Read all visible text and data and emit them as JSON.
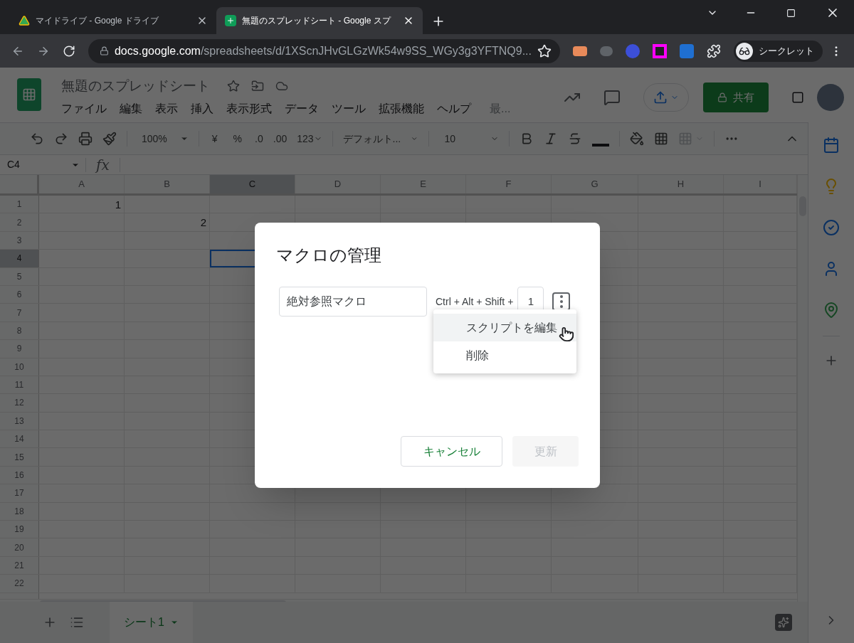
{
  "browser": {
    "tabs": [
      {
        "title": "マイドライブ - Google ドライブ",
        "kind": "drive",
        "selected": false
      },
      {
        "title": "無題のスプレッドシート - Google スプ",
        "kind": "sheets",
        "selected": true
      }
    ],
    "address": {
      "host": "docs.google.com",
      "path": "/spreadsheets/d/1XScnJHvGLGzWk54w9SS_WGy3g3YFTNQ9..."
    },
    "profile": "シークレット"
  },
  "doc": {
    "title": "無題のスプレッドシート",
    "menus": [
      "ファイル",
      "編集",
      "表示",
      "挿入",
      "表示形式",
      "データ",
      "ツール",
      "拡張機能",
      "ヘルプ",
      "最..."
    ],
    "share": "共有"
  },
  "toolbar": {
    "zoom": "100%",
    "currency": "¥",
    "percent": "%",
    "decimal_less": ".0",
    "decimal_more": ".00",
    "number_format": "123",
    "font": "デフォルト...",
    "font_size": "10"
  },
  "formula_bar": {
    "name_box": "C4",
    "fx": "fx"
  },
  "grid": {
    "columns": [
      {
        "label": "A",
        "selected": false
      },
      {
        "label": "B",
        "selected": false
      },
      {
        "label": "C",
        "selected": true
      },
      {
        "label": "D",
        "selected": false
      },
      {
        "label": "E",
        "selected": false
      },
      {
        "label": "F",
        "selected": false
      },
      {
        "label": "G",
        "selected": false
      },
      {
        "label": "H",
        "selected": false
      },
      {
        "label": "I",
        "selected": false
      }
    ],
    "rows": [
      {
        "label": "1",
        "selected": false,
        "cells": [
          "1",
          null,
          null,
          null,
          null,
          null,
          null,
          null,
          null
        ]
      },
      {
        "label": "2",
        "selected": false,
        "cells": [
          null,
          "2",
          null,
          null,
          null,
          null,
          null,
          null,
          null
        ]
      },
      {
        "label": "3",
        "selected": false
      },
      {
        "label": "4",
        "selected": true
      },
      {
        "label": "5",
        "selected": false
      },
      {
        "label": "6",
        "selected": false
      },
      {
        "label": "7",
        "selected": false
      },
      {
        "label": "8",
        "selected": false
      },
      {
        "label": "9",
        "selected": false
      },
      {
        "label": "10",
        "selected": false
      },
      {
        "label": "11",
        "selected": false
      },
      {
        "label": "12",
        "selected": false
      },
      {
        "label": "13",
        "selected": false
      },
      {
        "label": "14",
        "selected": false
      },
      {
        "label": "15",
        "selected": false
      },
      {
        "label": "16",
        "selected": false
      },
      {
        "label": "17",
        "selected": false
      },
      {
        "label": "18",
        "selected": false
      },
      {
        "label": "19",
        "selected": false
      },
      {
        "label": "20",
        "selected": false
      },
      {
        "label": "21",
        "selected": false
      },
      {
        "label": "22",
        "selected": false
      }
    ]
  },
  "sheets": [
    {
      "name": "シート1",
      "selected": true
    }
  ],
  "dialog": {
    "title": "マクロの管理",
    "macro_name": "絶対参照マクロ",
    "shortcut_label": "Ctrl + Alt + Shift +",
    "shortcut_key": "1",
    "menu": [
      {
        "label": "スクリプトを編集",
        "highlighted": true
      },
      {
        "label": "削除",
        "highlighted": false
      }
    ],
    "cancel": "キャンセル",
    "update": {
      "label": "更新",
      "disabled": true
    }
  }
}
